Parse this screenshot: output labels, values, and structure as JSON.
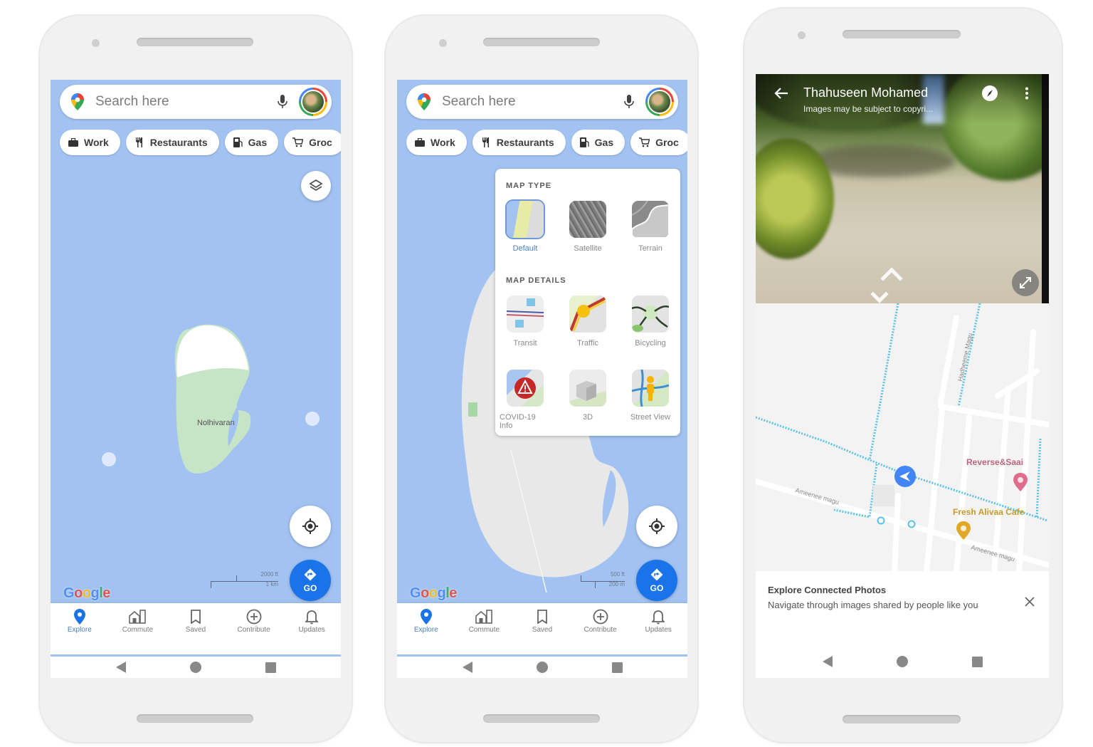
{
  "phones": [
    {
      "search": {
        "placeholder": "Search here"
      },
      "chips": [
        {
          "icon": "briefcase-icon",
          "label": "Work"
        },
        {
          "icon": "restaurant-icon",
          "label": "Restaurants"
        },
        {
          "icon": "gas-station-icon",
          "label": "Gas"
        },
        {
          "icon": "cart-icon",
          "label": "Groceries",
          "visible_label": "Groc"
        }
      ],
      "map": {
        "place_label": "Nolhivaran",
        "scale_primary": "2000 ft",
        "scale_secondary": "1 km",
        "logo": "Google"
      },
      "go_button": {
        "label": "GO"
      },
      "bottom_nav": [
        {
          "icon": "explore-pin-icon",
          "label": "Explore",
          "active": true
        },
        {
          "icon": "commute-icon",
          "label": "Commute"
        },
        {
          "icon": "saved-bookmark-icon",
          "label": "Saved"
        },
        {
          "icon": "contribute-plus-icon",
          "label": "Contribute"
        },
        {
          "icon": "updates-bell-icon",
          "label": "Updates"
        }
      ]
    },
    {
      "search": {
        "placeholder": "Search here"
      },
      "chips": [
        {
          "icon": "briefcase-icon",
          "label": "Work"
        },
        {
          "icon": "restaurant-icon",
          "label": "Restaurants"
        },
        {
          "icon": "gas-station-icon",
          "label": "Gas"
        },
        {
          "icon": "cart-icon",
          "label": "Groceries",
          "visible_label": "Groc"
        }
      ],
      "map_type_panel": {
        "map_type_heading": "MAP TYPE",
        "map_types": [
          {
            "label": "Default",
            "selected": true
          },
          {
            "label": "Satellite",
            "selected": false
          },
          {
            "label": "Terrain",
            "selected": false
          }
        ],
        "map_details_heading": "MAP DETAILS",
        "map_details": [
          {
            "label": "Transit"
          },
          {
            "label": "Traffic"
          },
          {
            "label": "Bicycling"
          },
          {
            "label": "COVID-19 Info"
          },
          {
            "label": "3D"
          },
          {
            "label": "Street View"
          }
        ]
      },
      "map": {
        "scale_primary": "500 ft",
        "scale_secondary": "200 m",
        "logo": "Google"
      },
      "go_button": {
        "label": "GO"
      },
      "bottom_nav": [
        {
          "icon": "explore-pin-icon",
          "label": "Explore",
          "active": true
        },
        {
          "icon": "commute-icon",
          "label": "Commute"
        },
        {
          "icon": "saved-bookmark-icon",
          "label": "Saved"
        },
        {
          "icon": "contribute-plus-icon",
          "label": "Contribute"
        },
        {
          "icon": "updates-bell-icon",
          "label": "Updates"
        }
      ]
    },
    {
      "street_view": {
        "author": "Thahuseen Mohamed",
        "subtitle": "Images may be subject to copyri...",
        "icons": [
          "back-arrow-icon",
          "compass-icon",
          "more-vert-icon",
          "fullscreen-icon"
        ]
      },
      "map": {
        "places": [
          {
            "name": "Reverse&Saai",
            "color": "#e06c8c"
          },
          {
            "name": "Fresh Alivaa Cafe",
            "color": "#e2a928"
          }
        ],
        "roads": [
          "Ameenee magu",
          "Ameenee magu",
          "Hadheeme Magu"
        ]
      },
      "card": {
        "title": "Explore Connected Photos",
        "description": "Navigate through images shared by people like you"
      }
    }
  ],
  "colors": {
    "water": "#a2c3f2",
    "accent": "#1a73e8",
    "park": "#c9e5c4",
    "street_view_line": "#5bc3e6"
  }
}
